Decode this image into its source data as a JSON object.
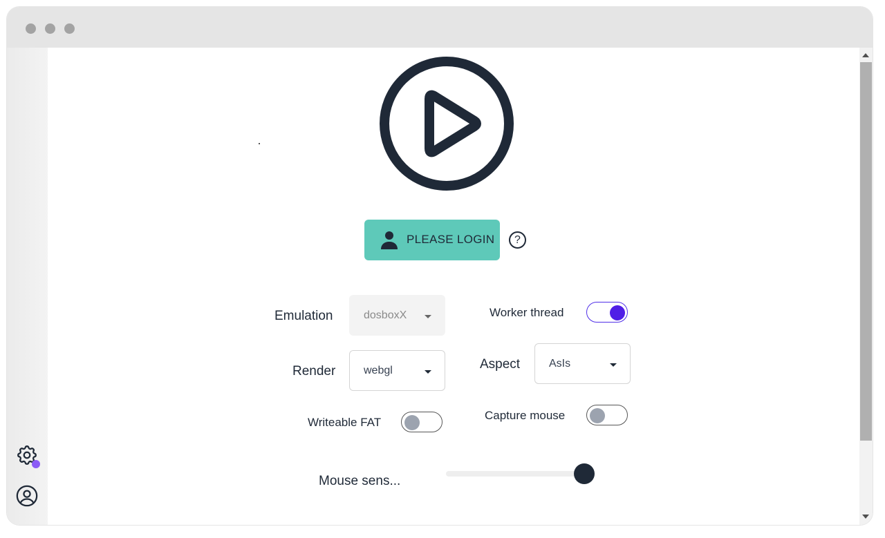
{
  "window": {
    "controls": [
      "close",
      "minimize",
      "maximize"
    ]
  },
  "sidebar": {
    "icons": [
      "gear-icon",
      "user-circle-icon"
    ],
    "badge_color": "#8b5cf6"
  },
  "hero": {
    "icon": "play-circle-icon"
  },
  "login": {
    "label": "PLEASE LOGIN",
    "icon": "user-icon",
    "bg_color": "#5ec9b9",
    "help_label": "?"
  },
  "settings": {
    "emulation": {
      "label": "Emulation",
      "value": "dosboxX",
      "disabled": true
    },
    "worker_thread": {
      "label": "Worker thread",
      "on": true
    },
    "render": {
      "label": "Render",
      "value": "webgl"
    },
    "aspect": {
      "label": "Aspect",
      "value": "AsIs"
    },
    "writeable_fat": {
      "label": "Writeable FAT",
      "on": false
    },
    "capture_mouse": {
      "label": "Capture mouse",
      "on": false
    },
    "mouse_sens": {
      "label": "Mouse sens...",
      "value_fraction": 0.95
    }
  },
  "colors": {
    "accent": "#4f1ee6",
    "dark": "#1f2937"
  }
}
